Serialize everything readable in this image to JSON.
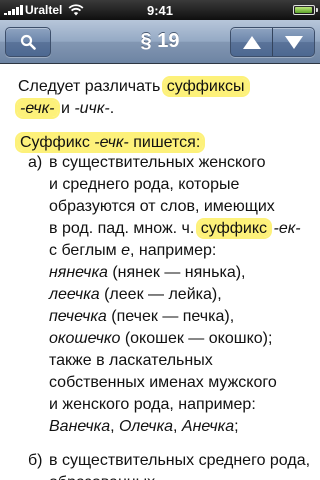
{
  "status_bar": {
    "carrier": "Uraltel",
    "time": "9:41",
    "battery_level": 0.95,
    "signal_bars": 5
  },
  "nav": {
    "title": "§ 19",
    "search_icon": "search-icon",
    "up_icon": "triangle-up-icon",
    "down_icon": "triangle-down-icon"
  },
  "colors": {
    "highlight": "#fdf17a",
    "nav_bar": "#8397b3"
  },
  "content": {
    "intro_1a": "Следует различать ",
    "intro_1b": "суффиксы",
    "intro_2a": "-ечк-",
    "intro_2b": " и ",
    "intro_2c": "-ичк-",
    "intro_2d": ".",
    "heading_a": "Суффикс ",
    "heading_b": "-ечк-",
    "heading_c": " пишется:",
    "a_marker": "а)",
    "a_l1": "в существительных женского",
    "a_l2": "и среднего рода, которые",
    "a_l3": "образуются от слов, имеющих",
    "a_l4a": "в род. пад. множ. ч. ",
    "a_l4b": "суффикс",
    "a_l4c": " ",
    "a_l4d": "-ек-",
    "a_l5a": "с беглым ",
    "a_l5b": "е",
    "a_l5c": ", например:",
    "ex1a": "нянечка",
    "ex1b": " (нянек — нянька),",
    "ex2a": "леечка",
    "ex2b": " (леек — лейка),",
    "ex3a": "печечка",
    "ex3b": " (печек — печка),",
    "ex4a": "окошечко",
    "ex4b": " (окошек — окошко);",
    "a_l10": "также в ласкательных",
    "a_l11": "собственных именах мужского",
    "a_l12": "и женского рода, например:",
    "names_a": "Ванечка",
    "names_sep1": ", ",
    "names_b": "Олечка",
    "names_sep2": ", ",
    "names_c": "Анечка",
    "names_end": ";",
    "b_marker": "б)",
    "b_l1": "в существительных среднего рода,",
    "b_l2": "образованных"
  }
}
